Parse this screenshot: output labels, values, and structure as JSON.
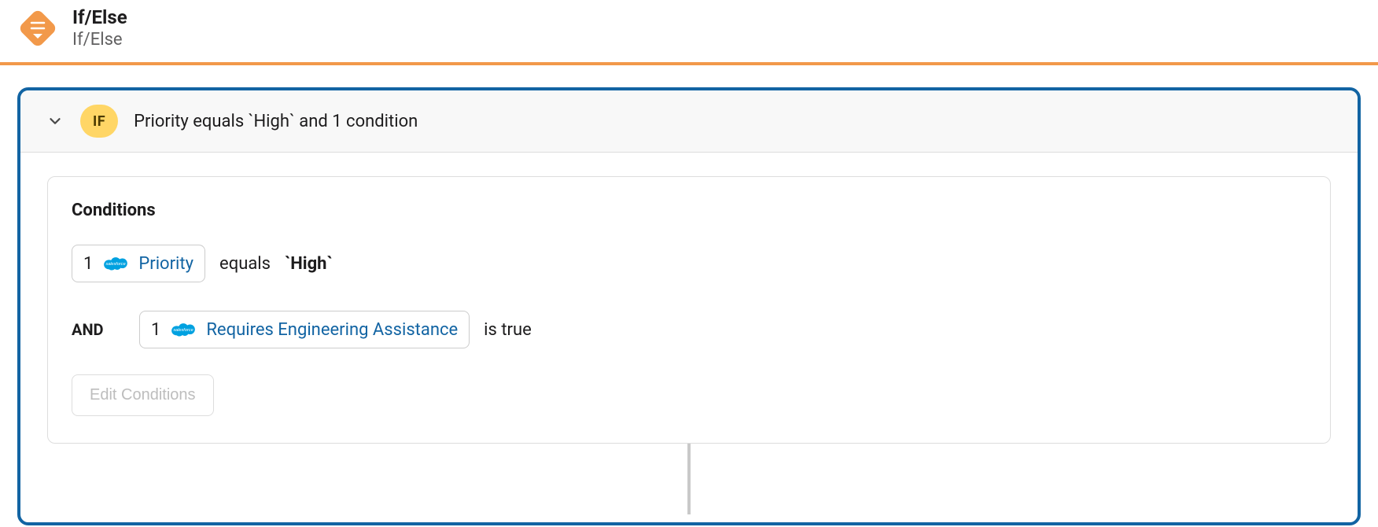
{
  "header": {
    "title": "If/Else",
    "subtitle": "If/Else"
  },
  "summary": {
    "badge": "IF",
    "text": "Priority equals `High` and 1 condition"
  },
  "conditions": {
    "title": "Conditions",
    "rows": [
      {
        "prefix": "",
        "step": "1",
        "field": "Priority",
        "operator": "equals",
        "value": "`High`"
      },
      {
        "prefix": "AND",
        "step": "1",
        "field": "Requires Engineering Assistance",
        "operator": "is true",
        "value": ""
      }
    ],
    "edit_label": "Edit Conditions"
  }
}
